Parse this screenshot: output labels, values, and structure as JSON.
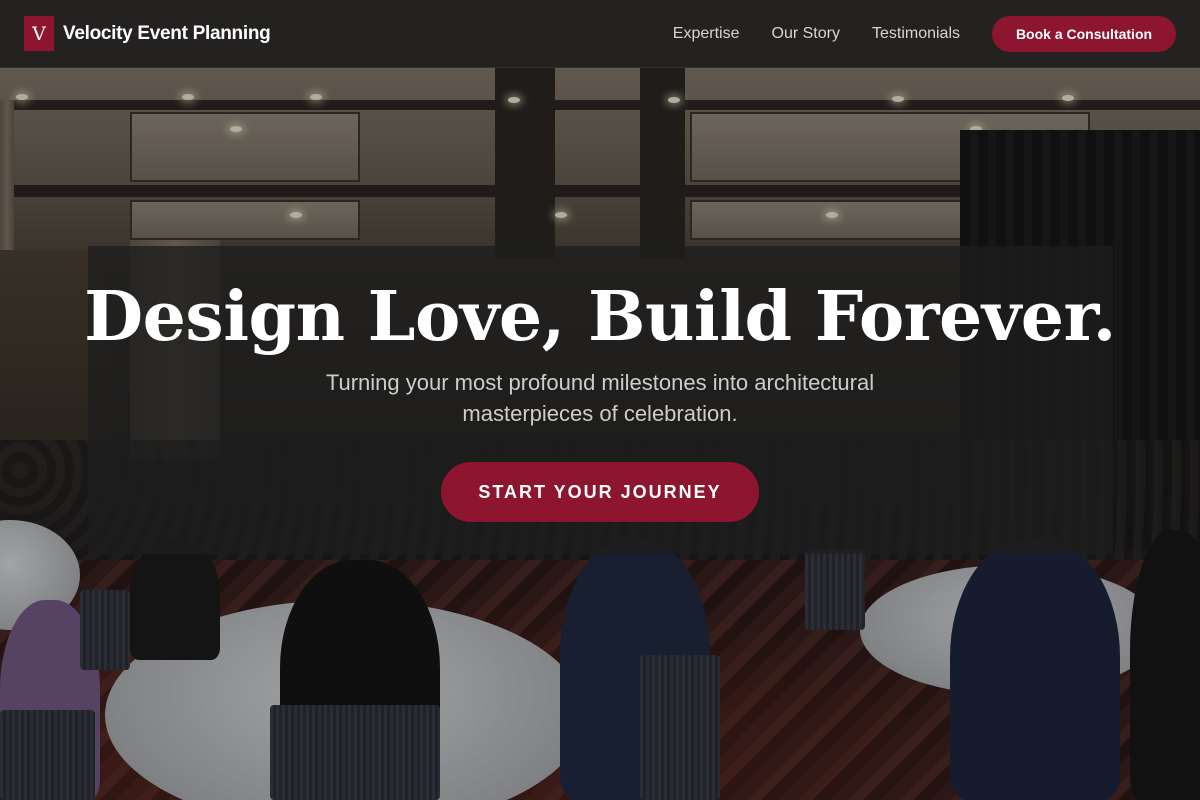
{
  "nav": {
    "brand_mark": "V",
    "brand_name": "Velocity Event Planning",
    "links": [
      {
        "label": "Expertise"
      },
      {
        "label": "Our Story"
      },
      {
        "label": "Testimonials"
      }
    ],
    "cta_label": "Book a Consultation"
  },
  "hero": {
    "headline": "Design Love, Build Forever.",
    "subheadline": "Turning your most profound milestones into architectural masterpieces of celebration.",
    "cta_label": "START YOUR JOURNEY",
    "background_description_icon": "banquet-hall-photo"
  },
  "colors": {
    "accent": "#8e1530",
    "navbar_bg": "#22211f",
    "overlay_bg": "#1e1e1e",
    "text_light": "#ffffff",
    "text_muted": "#cfcdc9"
  }
}
